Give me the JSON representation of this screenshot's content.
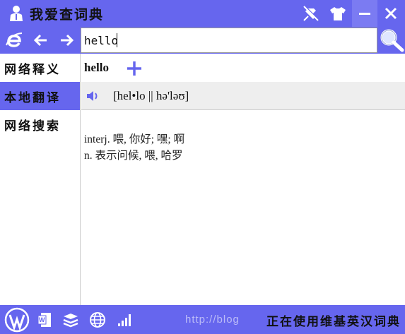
{
  "window": {
    "title": "我爱查词典"
  },
  "search": {
    "value": "hello"
  },
  "sidebar": {
    "items": [
      {
        "label": "网络释义",
        "active": false
      },
      {
        "label": "本地翻译",
        "active": true
      },
      {
        "label": "网络搜索",
        "active": false
      }
    ]
  },
  "entry": {
    "word": "hello",
    "phonetic": "[hel•lo || hə'ləʊ]",
    "definitions": [
      "interj. 喂, 你好; 嘿; 啊",
      "n. 表示问候, 喂, 哈罗"
    ]
  },
  "status": {
    "text": "正在使用维基英汉词典",
    "watermark": "http://blog"
  },
  "colors": {
    "accent": "#6666ee",
    "phonetic_bg": "#eeeeee",
    "add_icon": "#6666ee"
  },
  "icons": {
    "title": [
      "user-icon"
    ],
    "title_buttons": [
      "pin-icon",
      "shirt-icon",
      "minimize-icon",
      "close-icon"
    ],
    "search_bar": [
      "ie-icon",
      "back-arrow-icon",
      "forward-arrow-icon",
      "magnifier-icon"
    ],
    "bottom_bar": [
      "wordpress-icon",
      "word-doc-icon",
      "layers-icon",
      "globe-icon",
      "signal-icon"
    ]
  }
}
